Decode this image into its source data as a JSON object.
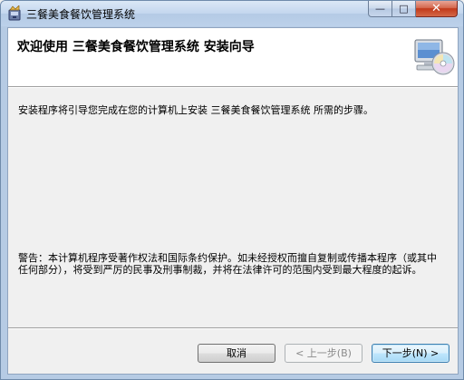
{
  "window": {
    "title": "三餐美食餐饮管理系统",
    "minimize_glyph": "—",
    "maximize_glyph": "□",
    "close_glyph": "✕"
  },
  "banner": {
    "title": "欢迎使用 三餐美食餐饮管理系统 安装向导",
    "icon": "computer-cd-icon"
  },
  "content": {
    "intro": "安装程序将引导您完成在您的计算机上安装 三餐美食餐饮管理系统 所需的步骤。",
    "warning": "警告：本计算机程序受著作权法和国际条约保护。如未经授权而擅自复制或传播本程序（或其中任何部分），将受到严厉的民事及刑事制裁，并将在法律许可的范围内受到最大程度的起诉。"
  },
  "buttons": {
    "cancel": "取消",
    "back": "< 上一步(B)",
    "next": "下一步(N) >"
  }
}
